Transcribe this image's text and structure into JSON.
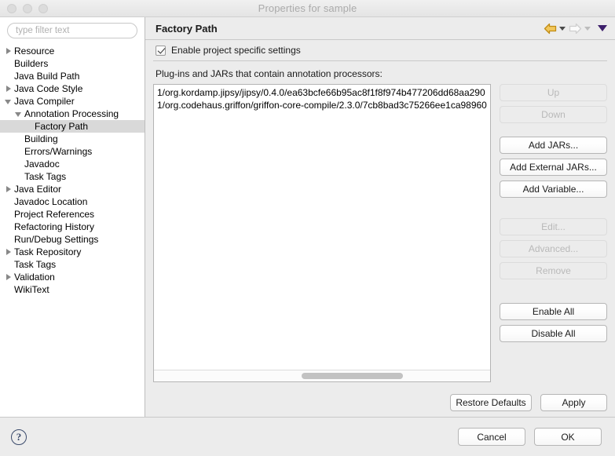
{
  "window": {
    "title": "Properties for sample",
    "traffic_lights": [
      "close-button",
      "minimize-button",
      "zoom-button"
    ]
  },
  "sidebar": {
    "filter": {
      "placeholder": "type filter text",
      "value": ""
    },
    "items": [
      {
        "label": "Resource",
        "indent": 0,
        "twisty": "collapsed",
        "selected": false
      },
      {
        "label": "Builders",
        "indent": 0,
        "twisty": "none",
        "selected": false
      },
      {
        "label": "Java Build Path",
        "indent": 0,
        "twisty": "none",
        "selected": false
      },
      {
        "label": "Java Code Style",
        "indent": 0,
        "twisty": "collapsed",
        "selected": false
      },
      {
        "label": "Java Compiler",
        "indent": 0,
        "twisty": "expanded",
        "selected": false
      },
      {
        "label": "Annotation Processing",
        "indent": 1,
        "twisty": "expanded",
        "selected": false
      },
      {
        "label": "Factory Path",
        "indent": 2,
        "twisty": "none",
        "selected": true
      },
      {
        "label": "Building",
        "indent": 1,
        "twisty": "none",
        "selected": false
      },
      {
        "label": "Errors/Warnings",
        "indent": 1,
        "twisty": "none",
        "selected": false
      },
      {
        "label": "Javadoc",
        "indent": 1,
        "twisty": "none",
        "selected": false
      },
      {
        "label": "Task Tags",
        "indent": 1,
        "twisty": "none",
        "selected": false
      },
      {
        "label": "Java Editor",
        "indent": 0,
        "twisty": "collapsed",
        "selected": false
      },
      {
        "label": "Javadoc Location",
        "indent": 0,
        "twisty": "none",
        "selected": false
      },
      {
        "label": "Project References",
        "indent": 0,
        "twisty": "none",
        "selected": false
      },
      {
        "label": "Refactoring History",
        "indent": 0,
        "twisty": "none",
        "selected": false
      },
      {
        "label": "Run/Debug Settings",
        "indent": 0,
        "twisty": "none",
        "selected": false
      },
      {
        "label": "Task Repository",
        "indent": 0,
        "twisty": "collapsed",
        "selected": false
      },
      {
        "label": "Task Tags",
        "indent": 0,
        "twisty": "none",
        "selected": false
      },
      {
        "label": "Validation",
        "indent": 0,
        "twisty": "collapsed",
        "selected": false
      },
      {
        "label": "WikiText",
        "indent": 0,
        "twisty": "none",
        "selected": false
      }
    ]
  },
  "pane": {
    "title": "Factory Path",
    "nav": {
      "back_icon": "back-arrow-icon",
      "back_color": "#d9a021",
      "forward_icon": "forward-arrow-icon",
      "forward_color": "#d6d6d6",
      "menu_icon": "chevron-down-icon",
      "menu_color": "#3d1f6b"
    },
    "enable_checkbox": {
      "label": "Enable project specific settings",
      "checked": true
    },
    "list_caption": "Plug-ins and JARs that contain annotation processors:",
    "list_rows": [
      "1/org.kordamp.jipsy/jipsy/0.4.0/ea63bcfe66b95ac8f1f8f974b477206dd68aa290",
      "1/org.codehaus.griffon/griffon-core-compile/2.3.0/7cb8bad3c75266ee1ca98960"
    ],
    "buttons": [
      {
        "label": "Up",
        "enabled": false
      },
      {
        "label": "Down",
        "enabled": false
      },
      {
        "label": "Add JARs...",
        "enabled": true
      },
      {
        "label": "Add External JARs...",
        "enabled": true
      },
      {
        "label": "Add Variable...",
        "enabled": true
      },
      {
        "label": "Edit...",
        "enabled": false
      },
      {
        "label": "Advanced...",
        "enabled": false
      },
      {
        "label": "Remove",
        "enabled": false
      },
      {
        "label": "Enable All",
        "enabled": true
      },
      {
        "label": "Disable All",
        "enabled": true
      }
    ],
    "restore_defaults_label": "Restore Defaults",
    "apply_label": "Apply"
  },
  "footer": {
    "help_icon": "help-icon",
    "help_glyph": "?",
    "cancel_label": "Cancel",
    "ok_label": "OK"
  }
}
